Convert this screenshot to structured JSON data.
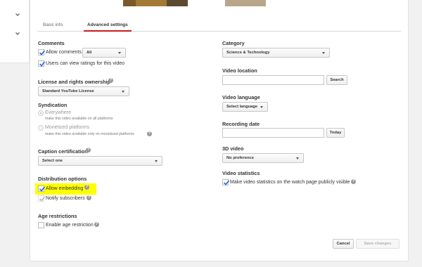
{
  "tabs": [
    {
      "label": "Basic info"
    },
    {
      "label": "Advanced settings"
    }
  ],
  "left": {
    "comments": {
      "title": "Comments",
      "allow_label": "Allow comments",
      "allow_select": "All",
      "ratings_label": "Users can view ratings for this video"
    },
    "license": {
      "title": "License and rights ownership",
      "select": "Standard YouTube License"
    },
    "syndication": {
      "title": "Syndication",
      "everywhere_label": "Everywhere",
      "everywhere_sub": "make this video available on all platforms",
      "monetized_label": "Monetized platforms",
      "monetized_sub": "make this video available only on monetized platforms"
    },
    "caption": {
      "title": "Caption certification",
      "select": "Select one"
    },
    "distribution": {
      "title": "Distribution options",
      "embedding_label": "Allow embedding",
      "notify_label": "Notify subscribers"
    },
    "age": {
      "title": "Age restrictions",
      "enable_label": "Enable age restriction"
    }
  },
  "right": {
    "category": {
      "title": "Category",
      "select": "Science & Technology"
    },
    "location": {
      "title": "Video location",
      "button": "Search"
    },
    "language": {
      "title": "Video language",
      "select": "Select language"
    },
    "recording": {
      "title": "Recording date",
      "button": "Today"
    },
    "threed": {
      "title": "3D video",
      "select": "No preference"
    },
    "stats": {
      "title": "Video statistics",
      "label": "Make video statistics on the watch page publicly visible"
    }
  },
  "footer": {
    "cancel": "Cancel",
    "save": "Save changes"
  },
  "colors": {
    "accent": "#cc181e",
    "highlight": "#ffff00",
    "check": "#2a6bd6"
  },
  "icons": [
    "chevron-down-icon",
    "help-icon",
    "check-icon",
    "caret-down-icon"
  ]
}
